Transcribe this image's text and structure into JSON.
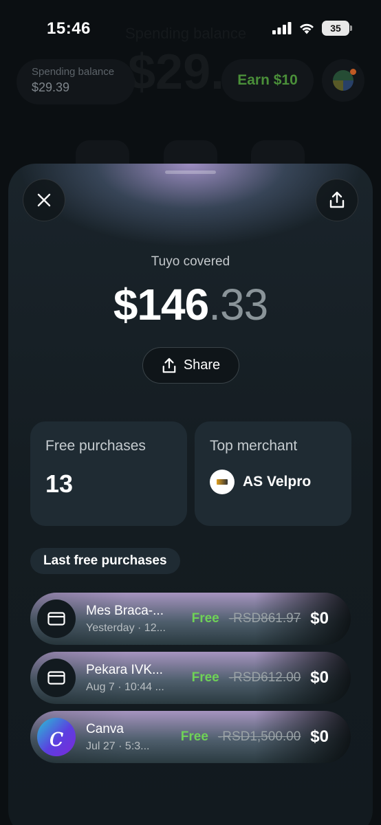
{
  "status_bar": {
    "time": "15:46",
    "battery": "35"
  },
  "background": {
    "spending_label": "Spending balance",
    "big_balance": "$29.",
    "balance_pill": {
      "label": "Spending balance",
      "value": "$29.39"
    },
    "earn_label": "Earn $10"
  },
  "sheet": {
    "covered_label": "Tuyo covered",
    "amount_whole": "$146",
    "amount_cents": ".33",
    "share_label": "Share",
    "free_purchases": {
      "label": "Free purchases",
      "value": "13"
    },
    "top_merchant": {
      "label": "Top merchant",
      "name": "AS Velpro"
    },
    "section_title": "Last free purchases",
    "purchases": [
      {
        "icon": "card-icon",
        "title": "Mes Braca-...",
        "subtitle": "Yesterday · 12...",
        "tag": "Free",
        "original": "-RSD861.97",
        "price": "$0"
      },
      {
        "icon": "card-icon",
        "title": "Pekara IVK...",
        "subtitle": "Aug 7 · 10:44 ...",
        "tag": "Free",
        "original": "-RSD612.00",
        "price": "$0"
      },
      {
        "icon": "canva-logo-icon",
        "title": "Canva",
        "subtitle": "Jul 27 · 5:3...",
        "tag": "Free",
        "original": "-RSD1,500.00",
        "price": "$0"
      }
    ]
  },
  "colors": {
    "accent_green": "#6fd257",
    "earn_green": "#4a8f39",
    "card_bg": "#1f2b33"
  }
}
